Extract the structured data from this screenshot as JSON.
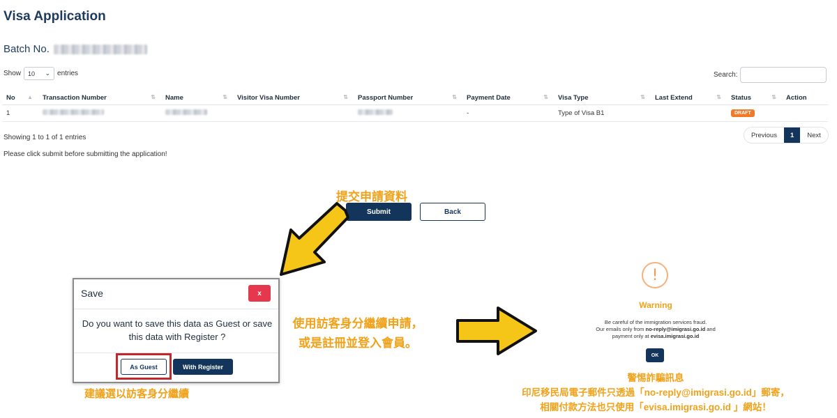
{
  "page": {
    "title": "Visa Application",
    "batch_label": "Batch No."
  },
  "table_controls": {
    "show_label": "Show",
    "entries_value": "10",
    "entries_label": "entries",
    "search_label": "Search:"
  },
  "table": {
    "columns": [
      "No",
      "Transaction Number",
      "Name",
      "Visitor Visa Number",
      "Passport Number",
      "Payment Date",
      "Visa Type",
      "Last Extend",
      "Status",
      "Action"
    ],
    "rows": [
      {
        "no": "1",
        "payment_date": "-",
        "visa_type": "Type of Visa B1",
        "status": "DRAFT"
      }
    ]
  },
  "footer": {
    "showing": "Showing 1 to 1 of 1 entries",
    "previous": "Previous",
    "page": "1",
    "next": "Next",
    "note": "Please click submit before submitting the application!"
  },
  "actions": {
    "submit": "Submit",
    "back": "Back"
  },
  "dialog": {
    "title": "Save",
    "close": "x",
    "message": "Do you want to save this data as Guest or save this data with Register ?",
    "guest": "As Guest",
    "register": "With Register"
  },
  "warning": {
    "title": "Warning",
    "line1": "Be careful of the immigration services fraud.",
    "line2_pre": "Our emails only from ",
    "line2_email": "no-reply@imigrasi.go.id",
    "line2_post": " and",
    "line3_pre": "payment only at ",
    "line3_site": "evisa.imigrasi.go.id",
    "ok": "OK"
  },
  "annotations": {
    "submit_hint": "提交申請資料",
    "middle_line1": "使用訪客身分繼續申請，",
    "middle_line2": "或是註冊並登入會員。",
    "suggest": "建議選以訪客身分繼續",
    "right_line1": "警惕詐騙訊息",
    "right_line2": "印尼移民局電子郵件只透過「no-reply@imigrasi.go.id」郵寄，",
    "right_line3": "相關付款方法也只使用「evisa.imigrasi.go.id 」網站！"
  },
  "colors": {
    "navy": "#13355b",
    "accent": "#f0a21b",
    "danger": "#e5384e",
    "draft": "#f07a27"
  }
}
